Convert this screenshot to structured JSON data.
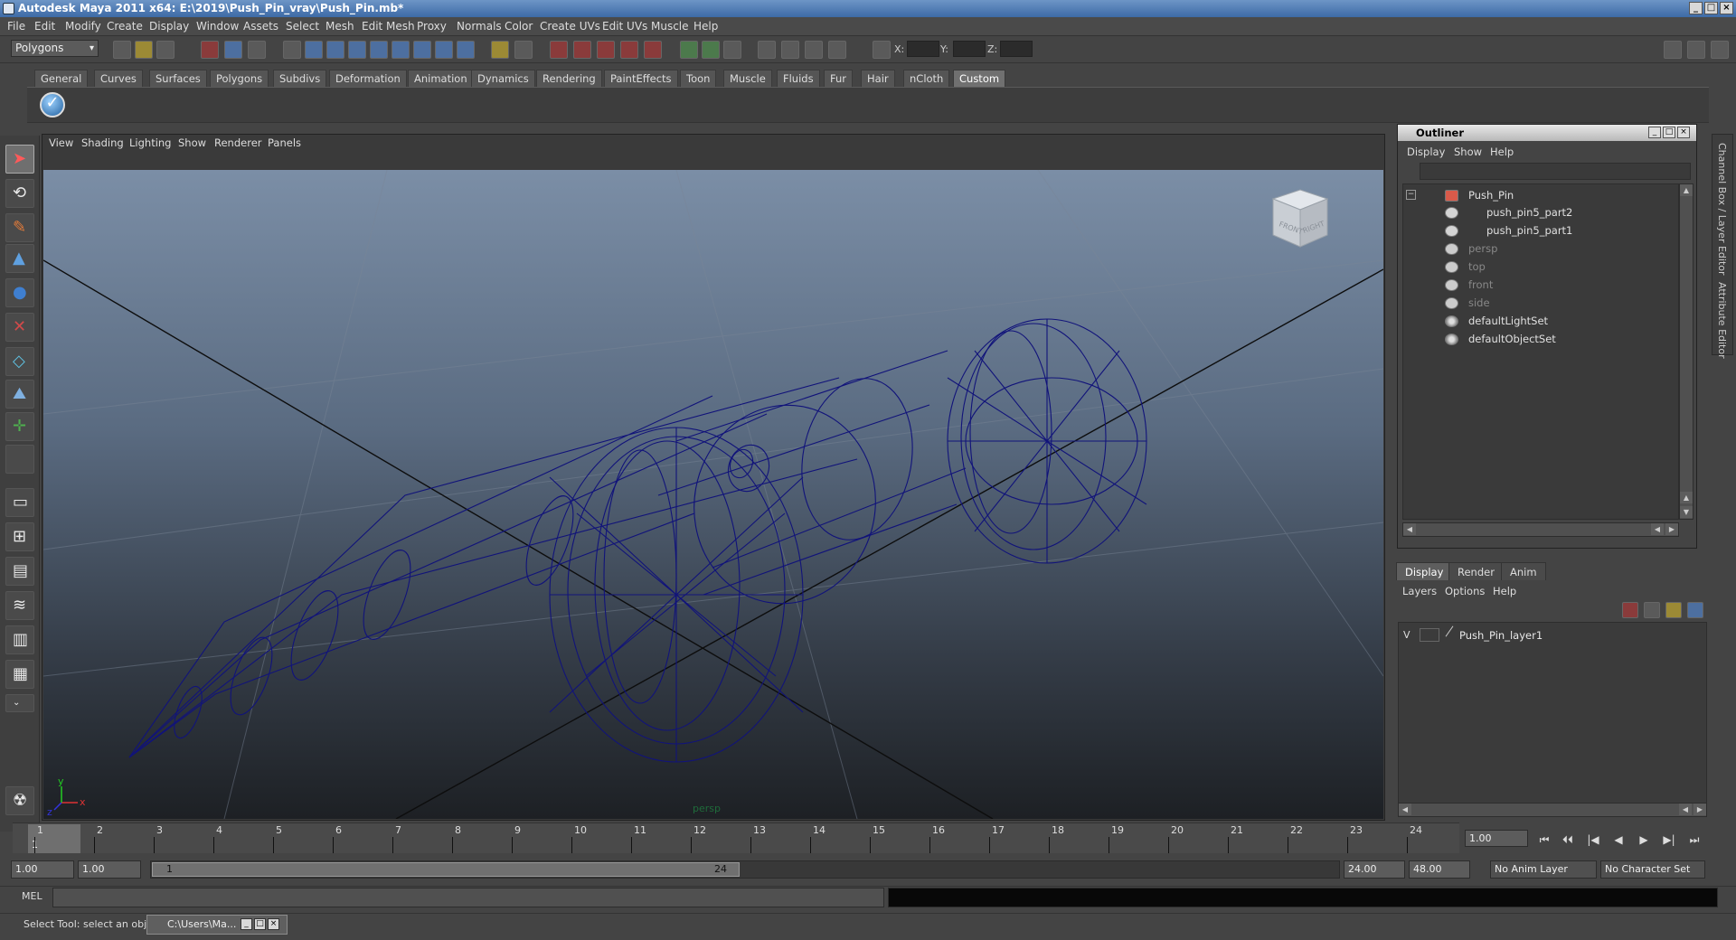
{
  "window": {
    "title": "Autodesk Maya 2011 x64: E:\\2019\\Push_Pin_vray\\Push_Pin.mb*",
    "minimize": "_",
    "maximize": "□",
    "close": "×"
  },
  "menus": [
    "File",
    "Edit",
    "Modify",
    "Create",
    "Display",
    "Window",
    "Assets",
    "Select",
    "Mesh",
    "Edit Mesh",
    "Proxy",
    "Normals",
    "Color",
    "Create UVs",
    "Edit UVs",
    "Muscle",
    "Help"
  ],
  "status_line": {
    "mode": "Polygons",
    "x_label": "X:",
    "y_label": "Y:",
    "z_label": "Z:"
  },
  "shelf_tabs": [
    "General",
    "Curves",
    "Surfaces",
    "Polygons",
    "Subdivs",
    "Deformation",
    "Animation",
    "Dynamics",
    "Rendering",
    "PaintEffects",
    "Toon",
    "Muscle",
    "Fluids",
    "Fur",
    "Hair",
    "nCloth",
    "Custom"
  ],
  "shelf_active_tab": "Custom",
  "panel_menu": [
    "View",
    "Shading",
    "Lighting",
    "Show",
    "Renderer",
    "Panels"
  ],
  "viewport": {
    "camera_label": "persp",
    "view_cube_front": "FRONT",
    "view_cube_right": "RIGHT",
    "axis_x": "x",
    "axis_y": "y",
    "axis_z": "z",
    "wire_color": "#11137a"
  },
  "outliner": {
    "title": "Outliner",
    "menu": [
      "Display",
      "Show",
      "Help"
    ],
    "items": [
      {
        "label": "Push_Pin"
      },
      {
        "label": "push_pin5_part2"
      },
      {
        "label": "push_pin5_part1"
      },
      {
        "label": "persp"
      },
      {
        "label": "top"
      },
      {
        "label": "front"
      },
      {
        "label": "side"
      },
      {
        "label": "defaultLightSet"
      },
      {
        "label": "defaultObjectSet"
      }
    ]
  },
  "side_tabs": [
    "Channel Box / Layer Editor",
    "Attribute Editor"
  ],
  "layers": {
    "tabs": [
      "Display",
      "Render",
      "Anim"
    ],
    "active_tab": "Display",
    "menu": [
      "Layers",
      "Options",
      "Help"
    ],
    "layer": {
      "visibility": "V",
      "name": "Push_Pin_layer1"
    }
  },
  "timeline": {
    "tick_labels": [
      "1",
      "2",
      "3",
      "4",
      "5",
      "6",
      "7",
      "8",
      "9",
      "10",
      "11",
      "12",
      "13",
      "14",
      "15",
      "16",
      "17",
      "18",
      "19",
      "20",
      "21",
      "22",
      "23",
      "24"
    ],
    "current_frame_marker": "1",
    "current_frame": "1.00",
    "playback": [
      "⏮",
      "⏴⏴",
      "|◀",
      "◀",
      "▶",
      "▶|",
      "⏭"
    ]
  },
  "range": {
    "start": "1.00",
    "anim_start": "1.00",
    "slider_start": "1",
    "slider_end": "24",
    "end": "24.00",
    "anim_end": "48.00",
    "anim_layer": "No Anim Layer",
    "character_set": "No Character Set"
  },
  "command_line": {
    "label": "MEL"
  },
  "help_line": {
    "text": "Select Tool: select an object",
    "task_label": "C:\\Users\\Ma..."
  }
}
